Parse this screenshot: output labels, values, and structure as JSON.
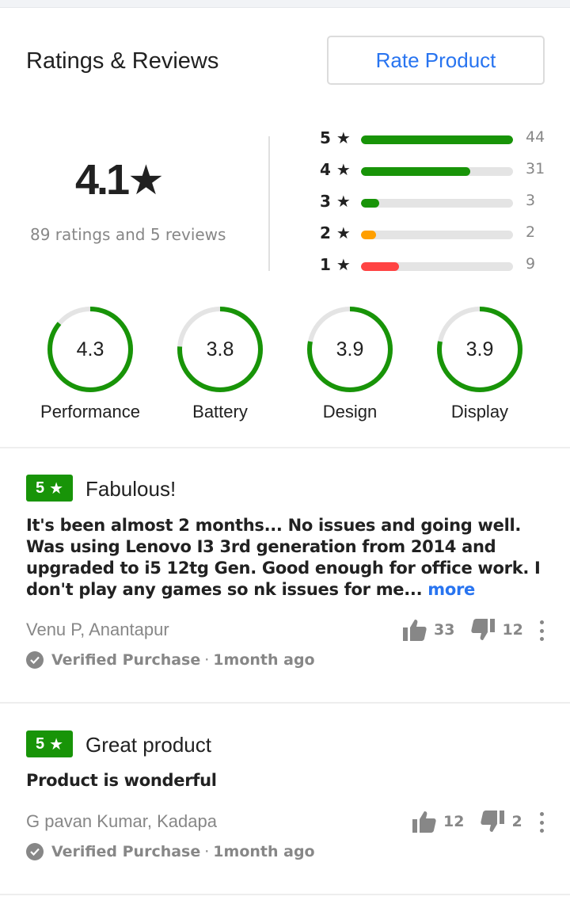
{
  "header": {
    "title": "Ratings & Reviews",
    "rate_button": "Rate Product"
  },
  "summary": {
    "average": "4.1",
    "star": "★",
    "counts_text": "89 ratings and 5 reviews",
    "distribution": [
      {
        "label": "5 ★",
        "count": "44",
        "fraction": 1.0,
        "color": "#189408"
      },
      {
        "label": "4 ★",
        "count": "31",
        "fraction": 0.72,
        "color": "#189408"
      },
      {
        "label": "3 ★",
        "count": "3",
        "fraction": 0.12,
        "color": "#189408"
      },
      {
        "label": "2 ★",
        "count": "2",
        "fraction": 0.1,
        "color": "#ff9f00"
      },
      {
        "label": "1 ★",
        "count": "9",
        "fraction": 0.25,
        "color": "#ff4343"
      }
    ]
  },
  "aspects": [
    {
      "value": "4.3",
      "label": "Performance",
      "fraction": 0.86
    },
    {
      "value": "3.8",
      "label": "Battery",
      "fraction": 0.76
    },
    {
      "value": "3.9",
      "label": "Design",
      "fraction": 0.78
    },
    {
      "value": "3.9",
      "label": "Display",
      "fraction": 0.78
    }
  ],
  "colors": {
    "accent": "#2874f0",
    "rating_green": "#189408",
    "muted": "#878787"
  },
  "reviews": [
    {
      "rating": "5",
      "star": "★",
      "title": "Fabulous!",
      "body": "It's been almost 2 months... No issues and going well. Was using Lenovo I3 3rd generation from 2014 and upgraded to i5 12tg Gen. Good enough for office work. I don't play any games so nk issues for me...",
      "more": "more",
      "author": "Venu P, Anantapur",
      "verified": "Verified Purchase",
      "separator": "·",
      "time": "1month ago",
      "likes": "33",
      "dislikes": "12"
    },
    {
      "rating": "5",
      "star": "★",
      "title": "Great product",
      "body": "Product is wonderful",
      "more": "",
      "author": "G pavan Kumar, Kadapa",
      "verified": "Verified Purchase",
      "separator": "·",
      "time": "1month ago",
      "likes": "12",
      "dislikes": "2"
    }
  ]
}
